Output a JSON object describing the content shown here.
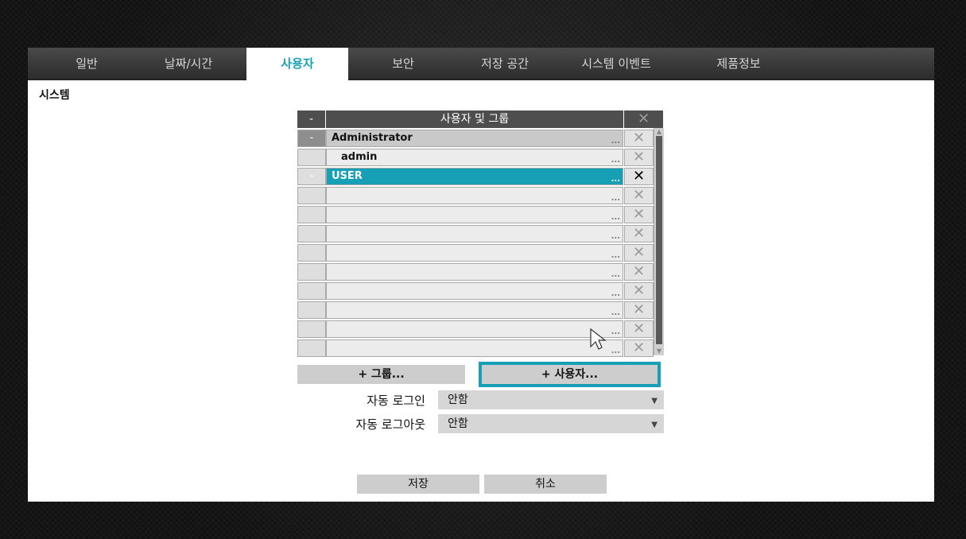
{
  "tabs": [
    {
      "label": "일반"
    },
    {
      "label": "날짜/시간"
    },
    {
      "label": "사용자"
    },
    {
      "label": "보안"
    },
    {
      "label": "저장 공간"
    },
    {
      "label": "시스템 이벤트"
    },
    {
      "label": "제품정보"
    }
  ],
  "active_tab": "사용자",
  "section_title": "시스템",
  "table": {
    "header_collapse": "-",
    "header_title": "사용자 및 그룹",
    "rows": [
      {
        "collapse": "-",
        "name": "Administrator",
        "dots": "...",
        "delete": "✕"
      },
      {
        "collapse": "",
        "name": "admin",
        "dots": "...",
        "delete": "✕"
      },
      {
        "collapse": "-",
        "name": "USER",
        "dots": "...",
        "delete": "✕"
      },
      {
        "collapse": "",
        "name": "",
        "dots": "...",
        "delete": "✕"
      },
      {
        "collapse": "",
        "name": "",
        "dots": "...",
        "delete": "✕"
      },
      {
        "collapse": "",
        "name": "",
        "dots": "...",
        "delete": "✕"
      },
      {
        "collapse": "",
        "name": "",
        "dots": "...",
        "delete": "✕"
      },
      {
        "collapse": "",
        "name": "",
        "dots": "...",
        "delete": "✕"
      },
      {
        "collapse": "",
        "name": "",
        "dots": "...",
        "delete": "✕"
      },
      {
        "collapse": "",
        "name": "",
        "dots": "...",
        "delete": "✕"
      },
      {
        "collapse": "",
        "name": "",
        "dots": "...",
        "delete": "✕"
      },
      {
        "collapse": "",
        "name": "",
        "dots": "...",
        "delete": "✕"
      }
    ]
  },
  "buttons": {
    "add_group": "+ 그룹...",
    "add_user": "+ 사용자...",
    "save": "저장",
    "cancel": "취소"
  },
  "auto_login": {
    "label": "자동 로그인",
    "value": "안함"
  },
  "auto_logout": {
    "label": "자동 로그아웃",
    "value": "안함"
  },
  "colors": {
    "accent": "#17a0b5",
    "tabbar": "#3a3a3a",
    "panel": "#ffffff"
  }
}
